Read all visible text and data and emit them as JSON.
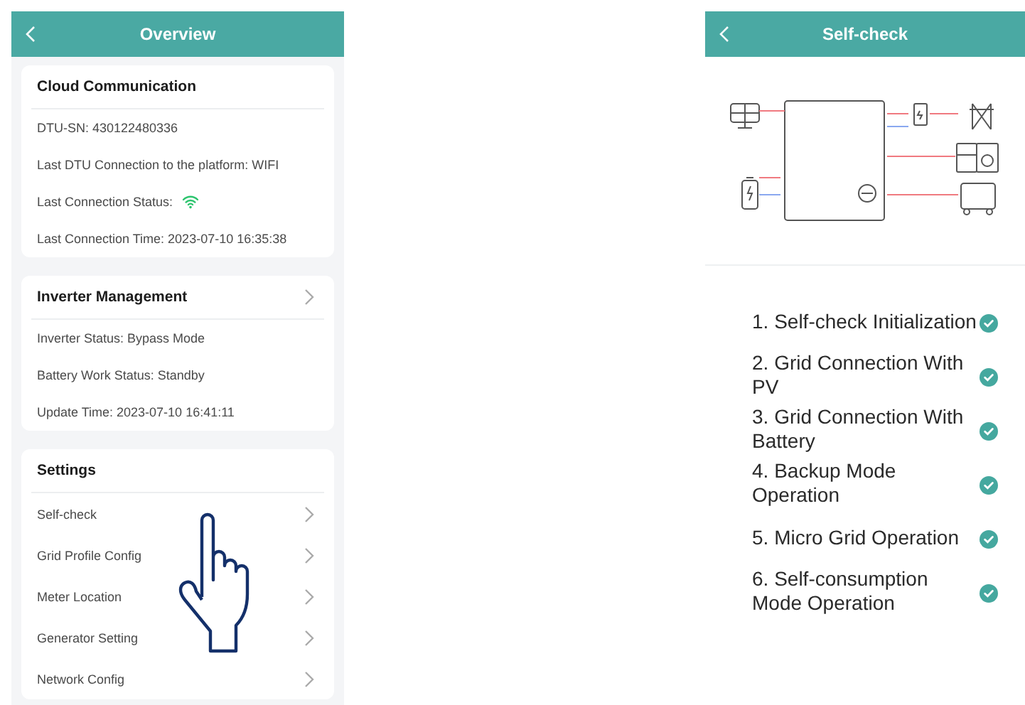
{
  "overview": {
    "title": "Overview",
    "cloud": {
      "title": "Cloud Communication",
      "rows": [
        {
          "kind": "text",
          "text": "DTU-SN: 430122480336"
        },
        {
          "kind": "text",
          "text": "Last DTU Connection to the platform: WIFI"
        },
        {
          "kind": "wifi",
          "text": "Last Connection Status:"
        },
        {
          "kind": "text",
          "text": "Last Connection Time: 2023-07-10 16:35:38"
        }
      ]
    },
    "inverter": {
      "title": "Inverter Management",
      "rows": [
        "Inverter Status: Bypass Mode",
        "Battery Work Status: Standby",
        "Update Time: 2023-07-10 16:41:11"
      ]
    },
    "settings": {
      "title": "Settings",
      "items": [
        "Self-check",
        "Grid Profile Config",
        "Meter Location",
        "Generator Setting",
        "Network Config"
      ]
    }
  },
  "self_check": {
    "title": "Self-check",
    "steps": [
      {
        "label": "1. Self-check Initialization",
        "checked": true
      },
      {
        "label": "2. Grid Connection With PV",
        "checked": true
      },
      {
        "label": "3. Grid Connection With Battery",
        "checked": true
      },
      {
        "label": "4. Backup Mode Operation",
        "checked": true
      },
      {
        "label": "5. Micro Grid Operation",
        "checked": true
      },
      {
        "label": "6. Self-consumption Mode Operation",
        "checked": true
      }
    ]
  }
}
